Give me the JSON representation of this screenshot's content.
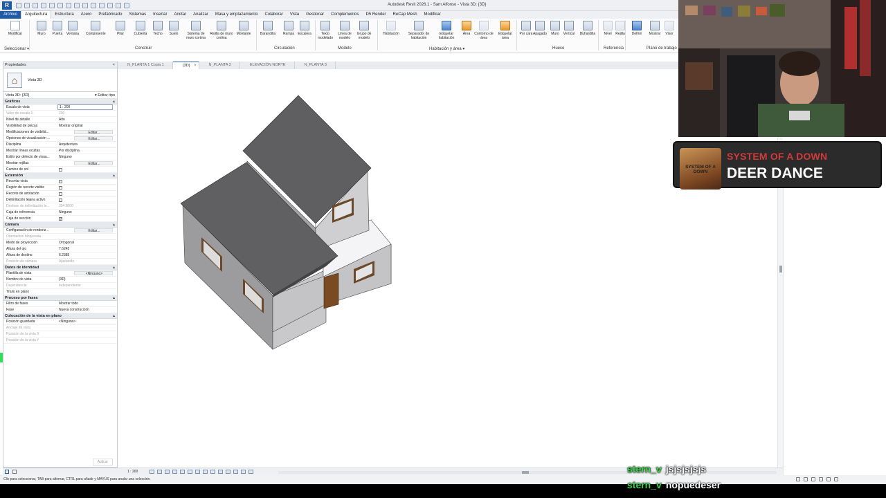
{
  "window": {
    "title": "Autodesk Revit 2026.1 - Sam Alfonso - Vista 3D: {3D}"
  },
  "ribbon": {
    "tabs": [
      "Archivo",
      "Arquitectura",
      "Estructura",
      "Acero",
      "Prefabricado",
      "Sistemas",
      "Insertar",
      "Anotar",
      "Analizar",
      "Masa y emplazamiento",
      "Colaborar",
      "Vista",
      "Gestionar",
      "Complementos",
      "D5 Render",
      "ReCap Mesh",
      "Modificar"
    ],
    "active_tab": "Arquitectura",
    "tools": {
      "modificar": "Modificar",
      "muro": "Muro",
      "puerta": "Puerta",
      "ventana": "Ventana",
      "componente": "Componente",
      "pilar": "Pilar",
      "cubierta": "Cubierta",
      "techo": "Techo",
      "suelo": "Suelo",
      "sistema_muro_cortina": "Sistema de muro cortina",
      "rejilla_muro_cortina": "Rejilla de muro cortina",
      "montante": "Montante",
      "barandilla": "Barandilla",
      "rampa": "Rampa",
      "escalera": "Escalera",
      "texto_modelado": "Texto modelado",
      "linea_modelo": "Línea de modelo",
      "grupo_modelo": "Grupo de modelo",
      "habitacion": "Habitación",
      "separador_habitacion": "Separador de habitación",
      "etiquetar_habitacion": "Etiquetar habitación",
      "area": "Área",
      "contorno_area": "Contorno de área",
      "etiquetar_area": "Etiquetar área",
      "por_cara": "Por cara",
      "apagado": "Apagado",
      "muro_hueco": "Muro",
      "vertical": "Vertical",
      "buhardilla": "Buhardilla",
      "nivel": "Nivel",
      "rejilla": "Rejilla",
      "definir": "Definir",
      "mostrar": "Mostrar",
      "visor": "Visor"
    },
    "panels": {
      "seleccionar": "Seleccionar ▾",
      "construir": "Construir",
      "circulacion": "Circulación",
      "modelo": "Modelo",
      "habitacion_area": "Habitación y área ▾",
      "hueco": "Hueco",
      "referencia": "Referencia",
      "plano_trabajo": "Plano de trabajo"
    }
  },
  "view_tabs": [
    {
      "label": "N_PLANTA 1 Copia 1",
      "active": false
    },
    {
      "label": "{3D}",
      "active": true
    },
    {
      "label": "N_PLANTA 2",
      "active": false
    },
    {
      "label": "ELEVACIÓN NORTE",
      "active": false
    },
    {
      "label": "N_PLANTA 3",
      "active": false
    }
  ],
  "properties": {
    "header": "Propiedades",
    "type_name": "Vista 3D",
    "instance_selector": "Vista 3D: {3D}",
    "edit_type": "Editar tipo",
    "sections": [
      {
        "title": "Gráficos",
        "rows": [
          {
            "k": "Escala de vista",
            "v": "1 : 200",
            "style": "input"
          },
          {
            "k": "Valor de escala    1:",
            "v": "200",
            "style": "dim"
          },
          {
            "k": "Nivel de detalle",
            "v": "Alto"
          },
          {
            "k": "Visibilidad de piezas",
            "v": "Mostrar original"
          },
          {
            "k": "Modificaciones de visibilid...",
            "v": "Editar...",
            "style": "btn"
          },
          {
            "k": "Opciones de visualización ...",
            "v": "Editar...",
            "style": "btn"
          },
          {
            "k": "Disciplina",
            "v": "Arquitectura"
          },
          {
            "k": "Mostrar líneas ocultas",
            "v": "Por disciplina"
          },
          {
            "k": "Estilo por defecto de visua...",
            "v": "Ninguno"
          },
          {
            "k": "Mostrar rejillas",
            "v": "Editar...",
            "style": "btn"
          },
          {
            "k": "Camino de sol",
            "v": "",
            "style": "check"
          }
        ]
      },
      {
        "title": "Extensión",
        "rows": [
          {
            "k": "Recortar vista",
            "v": "",
            "style": "check"
          },
          {
            "k": "Región de recorte visible",
            "v": "",
            "style": "check"
          },
          {
            "k": "Recorte de anotación",
            "v": "",
            "style": "check"
          },
          {
            "k": "Delimitación lejana activo",
            "v": "",
            "style": "check"
          },
          {
            "k": "Desfase de delimitación le...",
            "v": "304.8000",
            "style": "dim"
          },
          {
            "k": "Caja de referencia",
            "v": "Ninguno"
          },
          {
            "k": "Caja de sección",
            "v": "✓",
            "style": "check"
          }
        ]
      },
      {
        "title": "Cámara",
        "rows": [
          {
            "k": "Configuración de renderiz...",
            "v": "Editar...",
            "style": "btn"
          },
          {
            "k": "Orientación bloqueada",
            "v": "",
            "style": "dim"
          },
          {
            "k": "Modo de proyección",
            "v": "Ortogonal"
          },
          {
            "k": "Altura del ojo",
            "v": "7.6245"
          },
          {
            "k": "Altura de destino",
            "v": "6.2385"
          },
          {
            "k": "Posición de cámara",
            "v": "Ajustando",
            "style": "dim"
          }
        ]
      },
      {
        "title": "Datos de identidad",
        "rows": [
          {
            "k": "Plantilla de vista",
            "v": "<Ninguno>",
            "style": "btn"
          },
          {
            "k": "Nombre de vista",
            "v": "{3D}"
          },
          {
            "k": "Dependencia",
            "v": "Independiente",
            "style": "dim"
          },
          {
            "k": "Título en plano",
            "v": ""
          }
        ]
      },
      {
        "title": "Proceso por fases",
        "rows": [
          {
            "k": "Filtro de fases",
            "v": "Mostrar todo"
          },
          {
            "k": "Fase",
            "v": "Nueva construcción"
          }
        ]
      },
      {
        "title": "Colocación de la vista en plano",
        "rows": [
          {
            "k": "Posición guardada",
            "v": "<Ninguno>"
          },
          {
            "k": "Anclaje de vista",
            "v": "",
            "style": "dim"
          },
          {
            "k": "Posición de la vista X",
            "v": "",
            "style": "dim"
          },
          {
            "k": "Posición de la vista Y",
            "v": "",
            "style": "dim"
          }
        ]
      }
    ],
    "apply": "Aplicar"
  },
  "view_control": {
    "scale": "1 : 200"
  },
  "statusbar": {
    "hint": "Clic para seleccionar, TAB para alternar, CTRL para añadir y MAYÚS para anular una selección."
  },
  "overlay": {
    "now_playing": {
      "artist": "SYSTEM OF A DOWN",
      "title": "DEER DANCE",
      "art_text": "SYSTEM OF A DOWN"
    },
    "chat": [
      {
        "user": "stern_v",
        "message": "jsjsjsjsjs"
      },
      {
        "user": "stern_v",
        "message": "nopuedeser"
      }
    ]
  },
  "colors": {
    "accent": "#1f5aa6",
    "roof": "#5f5f61",
    "wall": "#c8c8cb",
    "chat_user": "#39d64b",
    "artist": "#d23a3a"
  }
}
